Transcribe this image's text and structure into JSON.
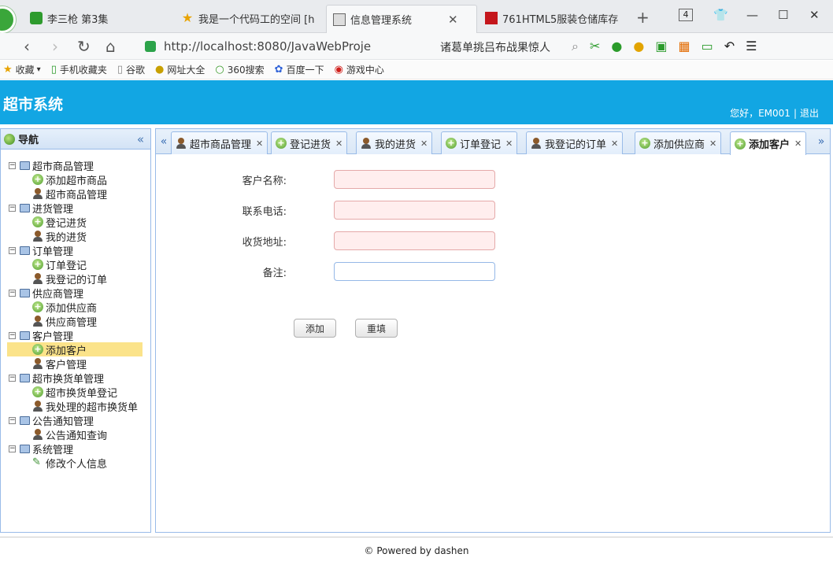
{
  "browser": {
    "tabs": [
      {
        "title": "李三枪 第3集",
        "favicon": "video-icon"
      },
      {
        "title": "我是一个代码工的空间 [h",
        "favicon": "star-icon"
      },
      {
        "title": "信息管理系统",
        "favicon": "page-icon",
        "active": true
      },
      {
        "title": "761HTML5服装仓储库存",
        "favicon": "red-square-icon"
      }
    ],
    "tab_count": "4",
    "url": "http://localhost:8080/JavaWebProje",
    "search_text": "诸葛单挑吕布战果惊人",
    "bookmarks": [
      "收藏",
      "手机收藏夹",
      "谷歌",
      "网址大全",
      "360搜索",
      "百度一下",
      "游戏中心"
    ]
  },
  "header": {
    "title": "超市系统",
    "greeting": "您好，EM001",
    "separator": "|",
    "logout": "退出"
  },
  "sidebar": {
    "title": "导航",
    "groups": [
      {
        "label": "超市商品管理",
        "items": [
          "添加超市商品",
          "超市商品管理"
        ]
      },
      {
        "label": "进货管理",
        "items": [
          "登记进货",
          "我的进货"
        ]
      },
      {
        "label": "订单管理",
        "items": [
          "订单登记",
          "我登记的订单"
        ]
      },
      {
        "label": "供应商管理",
        "items": [
          "添加供应商",
          "供应商管理"
        ]
      },
      {
        "label": "客户管理",
        "items": [
          "添加客户",
          "客户管理"
        ]
      },
      {
        "label": "超市换货单管理",
        "items": [
          "超市换货单登记",
          "我处理的超市换货单"
        ]
      },
      {
        "label": "公告通知管理",
        "items": [
          "公告通知查询"
        ]
      },
      {
        "label": "系统管理",
        "items": [
          "修改个人信息"
        ]
      }
    ]
  },
  "tabs": [
    "超市商品管理",
    "登记进货",
    "我的进货",
    "订单登记",
    "我登记的订单",
    "添加供应商",
    "添加客户"
  ],
  "form": {
    "name_label": "客户名称:",
    "phone_label": "联系电话:",
    "address_label": "收货地址:",
    "note_label": "备注:",
    "add_button": "添加",
    "reset_button": "重填"
  },
  "footer": "© Powered by dashen"
}
